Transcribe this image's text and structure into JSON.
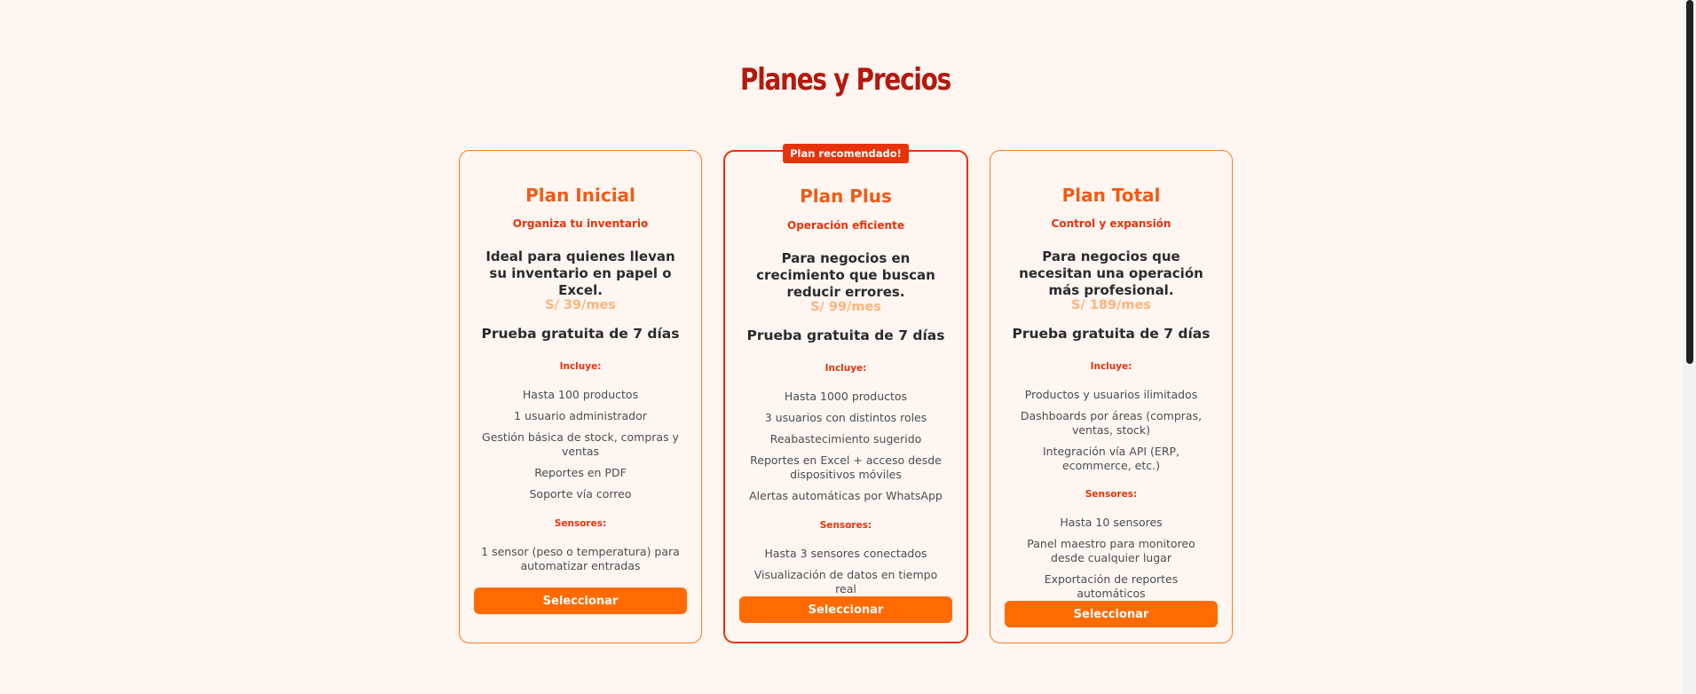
{
  "page": {
    "title": "Planes y Precios"
  },
  "colors": {
    "accent": "#ff6b00",
    "title": "#b5180c",
    "plan_name": "#f25a16",
    "price": "#ffb37a",
    "background": "#fff6f1"
  },
  "plans": [
    {
      "name": "Plan Inicial",
      "tagline": "Organiza tu inventario",
      "description": "Ideal para quienes llevan su inventario en papel o Excel.",
      "price": "S/ 39/mes",
      "trial": "Prueba gratuita de 7 días",
      "includes_label": "Incluye:",
      "includes": [
        "Hasta 100 productos",
        "1 usuario administrador",
        "Gestión básica de stock, compras y ventas",
        "Reportes en PDF",
        "Soporte vía correo"
      ],
      "sensors_label": "Sensores:",
      "sensors": [
        "1 sensor (peso o temperatura) para automatizar entradas"
      ],
      "button_label": "Seleccionar"
    },
    {
      "badge": "Plan recomendado!",
      "name": "Plan Plus",
      "tagline": "Operación eficiente",
      "description": "Para negocios en crecimiento que buscan reducir errores.",
      "price": "S/ 99/mes",
      "trial": "Prueba gratuita de 7 días",
      "includes_label": "Incluye:",
      "includes": [
        "Hasta 1000 productos",
        "3 usuarios con distintos roles",
        "Reabastecimiento sugerido",
        "Reportes en Excel + acceso desde dispositivos móviles",
        "Alertas automáticas por WhatsApp"
      ],
      "sensors_label": "Sensores:",
      "sensors": [
        "Hasta 3 sensores conectados",
        "Visualización de datos en tiempo real"
      ],
      "button_label": "Seleccionar"
    },
    {
      "name": "Plan Total",
      "tagline": "Control y expansión",
      "description": "Para negocios que necesitan una operación más profesional.",
      "price": "S/ 189/mes",
      "trial": "Prueba gratuita de 7 días",
      "includes_label": "Incluye:",
      "includes": [
        "Productos y usuarios ilimitados",
        "Dashboards por áreas (compras, ventas, stock)",
        "Integración vía API (ERP, ecommerce, etc.)"
      ],
      "sensors_label": "Sensores:",
      "sensors": [
        "Hasta 10 sensores",
        "Panel maestro para monitoreo desde cualquier lugar",
        "Exportación de reportes automáticos"
      ],
      "button_label": "Seleccionar"
    }
  ]
}
